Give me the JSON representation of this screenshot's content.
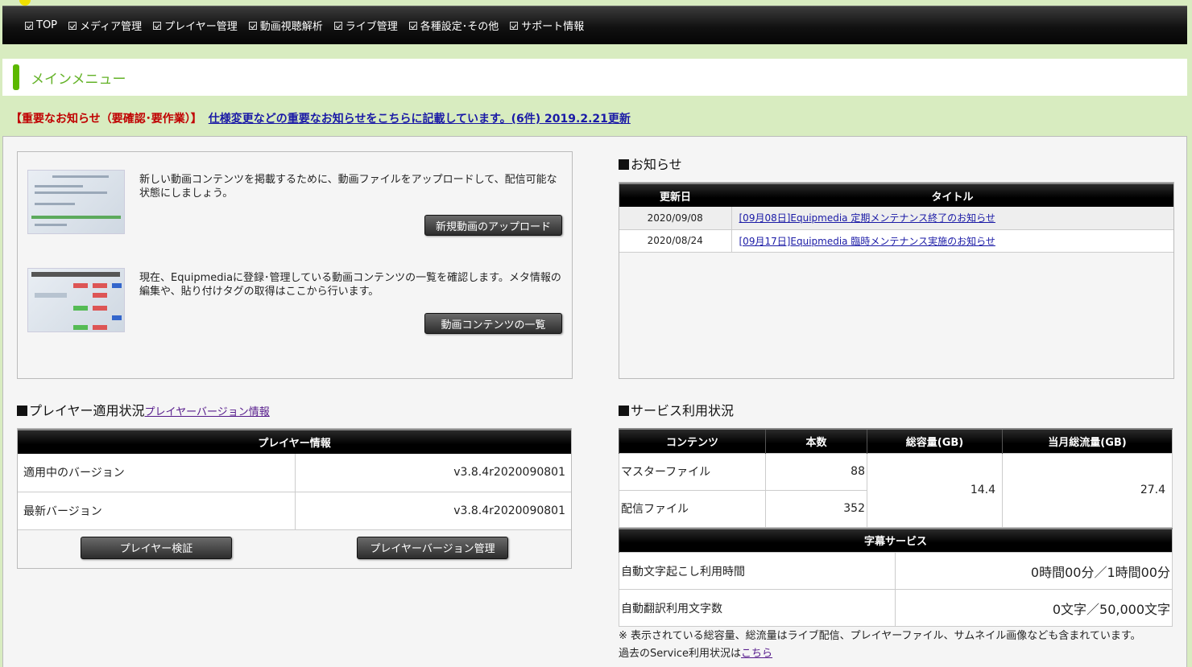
{
  "nav": {
    "items": [
      {
        "label": "TOP"
      },
      {
        "label": "メディア管理"
      },
      {
        "label": "プレイヤー管理"
      },
      {
        "label": "動画視聴解析"
      },
      {
        "label": "ライブ管理"
      },
      {
        "label": "各種設定･その他"
      },
      {
        "label": "サポート情報"
      }
    ]
  },
  "page": {
    "title": "メインメニュー"
  },
  "notice": {
    "tag": "【重要なお知らせ（要確認･要作業）】",
    "link": "仕様変更などの重要なお知らせをこちらに記載しています。(6件) 2019.2.21更新"
  },
  "quick": {
    "upload_text": "新しい動画コンテンツを掲載するために、動画ファイルをアップロードして、配信可能な状態にしましょう。",
    "upload_button": "新規動画のアップロード",
    "list_text": "現在、Equipmediaに登録･管理している動画コンテンツの一覧を確認します。メタ情報の編集や、貼り付けタグの取得はここから行います。",
    "list_button": "動画コンテンツの一覧"
  },
  "news": {
    "heading": "お知らせ",
    "col_date": "更新日",
    "col_title": "タイトル",
    "rows": [
      {
        "date": "2020/09/08",
        "title": "[09月08日]Equipmedia 定期メンテナンス終了のお知らせ"
      },
      {
        "date": "2020/08/24",
        "title": "[09月17日]Equipmedia 臨時メンテナンス実施のお知らせ"
      }
    ]
  },
  "player": {
    "heading": "プレイヤー適用状況",
    "heading_link": "プレイヤーバージョン情報",
    "table_title": "プレイヤー情報",
    "current_label": "適用中のバージョン",
    "current_value": "v3.8.4r2020090801",
    "latest_label": "最新バージョン",
    "latest_value": "v3.8.4r2020090801",
    "verify_button": "プレイヤー検証",
    "manage_button": "プレイヤーバージョン管理"
  },
  "service": {
    "heading": "サービス利用状況",
    "col_contents": "コンテンツ",
    "col_count": "本数",
    "col_storage": "総容量(GB)",
    "col_traffic": "当月総流量(GB)",
    "master_label": "マスターファイル",
    "master_count": "88",
    "delivery_label": "配信ファイル",
    "delivery_count": "352",
    "storage_total": "14.4",
    "traffic_total": "27.4",
    "caption_title": "字幕サービス",
    "transcribe_label": "自動文字起こし利用時間",
    "transcribe_value": "0時間00分／1時間00分",
    "translate_label": "自動翻訳利用文字数",
    "translate_value": "0文字／50,000文字",
    "note1": "※ 表示されている総容量、総流量はライブ配信、プレイヤーファイル、サムネイル画像なども含まれています。",
    "note2_prefix": "過去のService利用状況は",
    "note2_link": "こちら"
  },
  "colors": {
    "accent_green": "#5cb800",
    "title_green": "#63b227",
    "notice_red": "#c00000",
    "link_blue": "#1a1aa6",
    "page_bg": "#d8ecc0"
  }
}
